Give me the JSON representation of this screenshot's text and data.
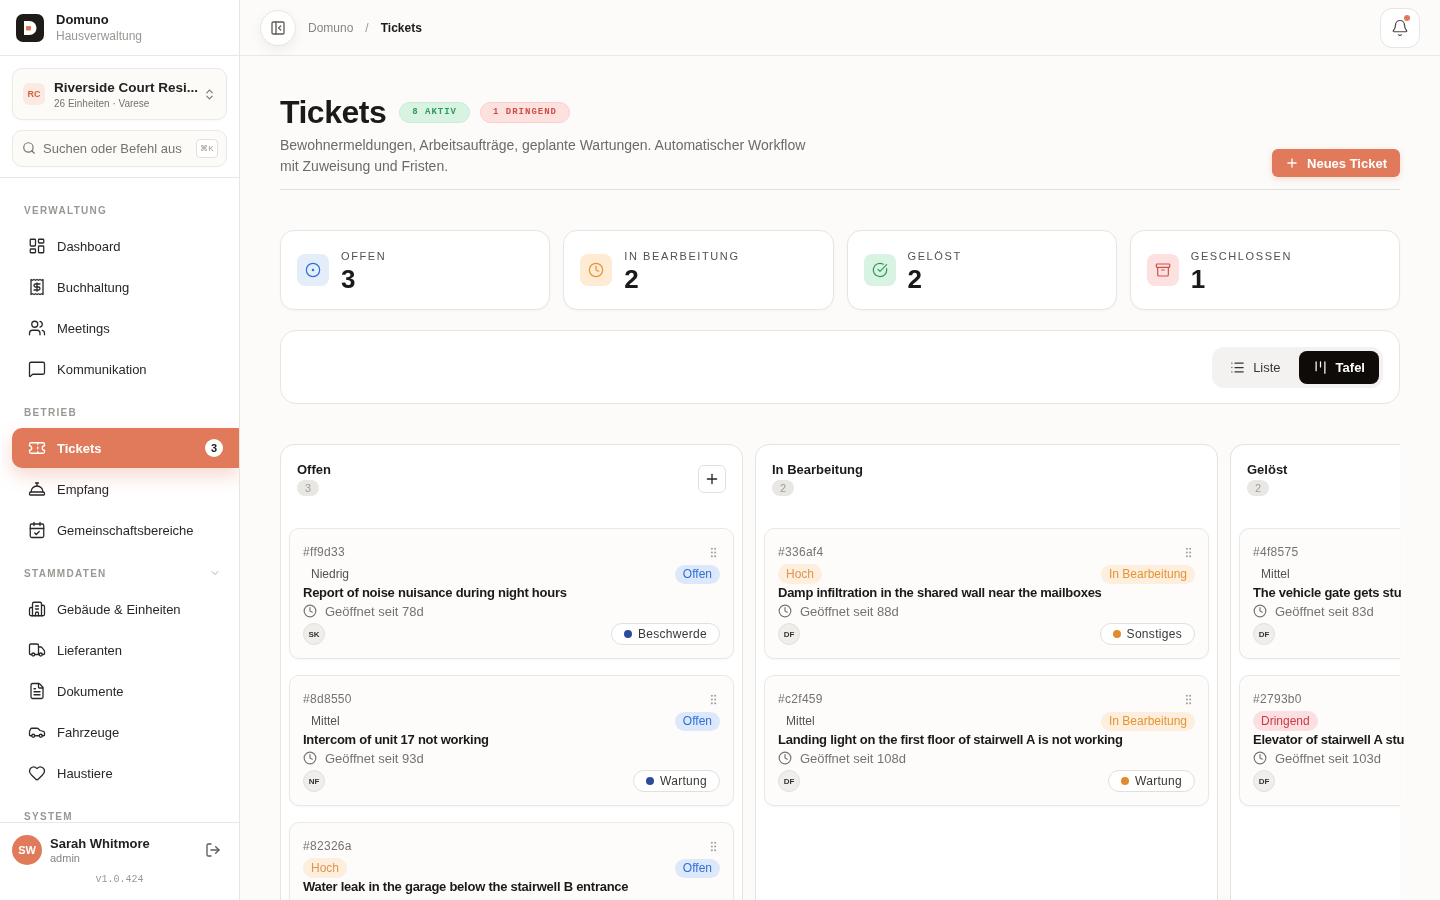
{
  "sidebar": {
    "brand": {
      "name": "Domuno",
      "subtitle": "Hausverwaltung"
    },
    "property": {
      "initials": "RC",
      "name": "Riverside Court Resi...",
      "details": "26 Einheiten · Varese"
    },
    "search": {
      "placeholder": "Suchen oder Befehl aus",
      "shortcut": "⌘K"
    },
    "sections": [
      {
        "title": "VERWALTUNG",
        "items": [
          {
            "label": "Dashboard",
            "selected": false
          },
          {
            "label": "Buchhaltung",
            "selected": false
          },
          {
            "label": "Meetings",
            "selected": false
          },
          {
            "label": "Kommunikation",
            "selected": false
          }
        ]
      },
      {
        "title": "BETRIEB",
        "items": [
          {
            "label": "Tickets",
            "selected": true,
            "badge": "3"
          },
          {
            "label": "Empfang",
            "selected": false
          },
          {
            "label": "Gemeinschaftsbereiche",
            "selected": false
          }
        ]
      },
      {
        "title": "STAMMDATEN",
        "expanded": true,
        "items": [
          {
            "label": "Gebäude & Einheiten",
            "selected": false
          },
          {
            "label": "Lieferanten",
            "selected": false
          },
          {
            "label": "Dokumente",
            "selected": false
          },
          {
            "label": "Fahrzeuge",
            "selected": false
          },
          {
            "label": "Haustiere",
            "selected": false
          }
        ]
      },
      {
        "title": "SYSTEM"
      }
    ],
    "user": {
      "initials": "SW",
      "name": "Sarah Whitmore",
      "role": "admin"
    },
    "version": "v1.0.424"
  },
  "topbar": {
    "breadcrumb": [
      {
        "label": "Domuno",
        "current": false
      },
      {
        "label": "Tickets",
        "current": true
      }
    ],
    "separator": "/",
    "notifications": {
      "unread": true
    }
  },
  "header": {
    "title": "Tickets",
    "badges": [
      {
        "label": "8 AKTIV",
        "kind": "success"
      },
      {
        "label": "1 DRINGEND",
        "kind": "danger"
      }
    ],
    "description": "Bewohnermeldungen, Arbeitsaufträge, geplante Wartungen. Automatischer Workflow mit Zuweisung und Fristen.",
    "action": "Neues Ticket"
  },
  "stats": [
    {
      "label": "OFFEN",
      "value": "3",
      "kind": "open"
    },
    {
      "label": "IN BEARBEITUNG",
      "value": "2",
      "kind": "in_progress"
    },
    {
      "label": "GELÖST",
      "value": "2",
      "kind": "resolved"
    },
    {
      "label": "GESCHLOSSEN",
      "value": "1",
      "kind": "closed"
    }
  ],
  "view_toggle": [
    {
      "label": "Liste",
      "selected": false
    },
    {
      "label": "Tafel",
      "selected": true
    }
  ],
  "board": {
    "columns": [
      {
        "title": "Offen",
        "count": "3",
        "can_add": true,
        "cards": [
          {
            "id": "#ff9d33",
            "priority": {
              "label": "Niedrig",
              "kind": "low"
            },
            "status": {
              "label": "Offen",
              "kind": "open"
            },
            "title": "Report of noise nuisance during night hours",
            "opened": "Geöffnet seit 78d",
            "assignee": "SK",
            "category": {
              "label": "Beschwerde",
              "color": "#2d4a9b"
            }
          },
          {
            "id": "#8d8550",
            "priority": {
              "label": "Mittel",
              "kind": "medium"
            },
            "status": {
              "label": "Offen",
              "kind": "open"
            },
            "title": "Intercom of unit 17 not working",
            "opened": "Geöffnet seit 93d",
            "assignee": "NF",
            "category": {
              "label": "Wartung",
              "color": "#2d4a9b"
            }
          },
          {
            "id": "#82326a",
            "priority": {
              "label": "Hoch",
              "kind": "high"
            },
            "status": {
              "label": "Offen",
              "kind": "open"
            },
            "title": "Water leak in the garage below the stairwell B entrance"
          }
        ]
      },
      {
        "title": "In Bearbeitung",
        "count": "2",
        "can_add": false,
        "cards": [
          {
            "id": "#336af4",
            "priority": {
              "label": "Hoch",
              "kind": "high"
            },
            "status": {
              "label": "In Bearbeitung",
              "kind": "in_progress"
            },
            "title": "Damp infiltration in the shared wall near the mailboxes",
            "opened": "Geöffnet seit 88d",
            "assignee": "DF",
            "category": {
              "label": "Sonstiges",
              "color": "#e08b2d"
            }
          },
          {
            "id": "#c2f459",
            "priority": {
              "label": "Mittel",
              "kind": "medium"
            },
            "status": {
              "label": "In Bearbeitung",
              "kind": "in_progress"
            },
            "title": "Landing light on the first floor of stairwell A is not working",
            "opened": "Geöffnet seit 108d",
            "assignee": "DF",
            "category": {
              "label": "Wartung",
              "color": "#e08b2d"
            }
          }
        ]
      },
      {
        "title": "Gelöst",
        "count": "2",
        "cards": [
          {
            "id": "#4f8575",
            "priority": {
              "label": "Mittel",
              "kind": "medium"
            },
            "title": "The vehicle gate gets stu",
            "opened": "Geöffnet seit 83d",
            "assignee": "DF"
          },
          {
            "id": "#2793b0",
            "priority": {
              "label": "Dringend",
              "kind": "urgent"
            },
            "title": "Elevator of stairwell A stu",
            "opened": "Geöffnet seit 103d",
            "assignee": "DF"
          }
        ]
      }
    ]
  }
}
